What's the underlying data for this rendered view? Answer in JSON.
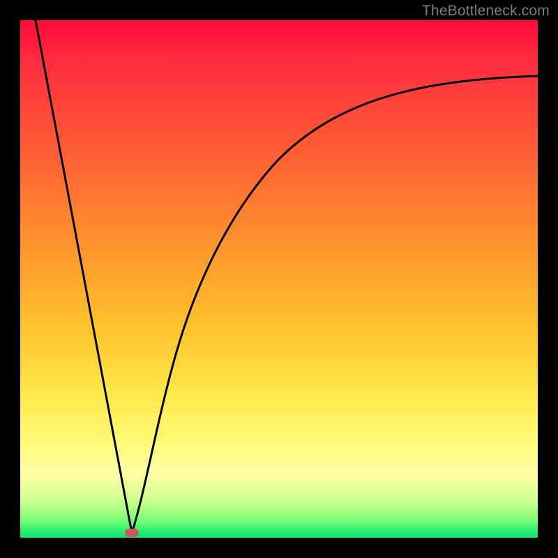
{
  "watermark": "TheBottleneck.com",
  "marker": {
    "x_frac": 0.215,
    "color": "#cb5a5f"
  },
  "chart_data": {
    "type": "line",
    "title": "",
    "xlabel": "",
    "ylabel": "",
    "xlim": [
      0,
      1
    ],
    "ylim": [
      0,
      1
    ],
    "background_gradient": [
      "#ff0a3a",
      "#ff8f2e",
      "#ffe74a",
      "#00e56b"
    ],
    "series": [
      {
        "name": "left-branch",
        "x": [
          0.03,
          0.06,
          0.09,
          0.12,
          0.15,
          0.18,
          0.215
        ],
        "values": [
          1.0,
          0.84,
          0.68,
          0.52,
          0.36,
          0.19,
          0.0
        ]
      },
      {
        "name": "right-branch",
        "x": [
          0.215,
          0.24,
          0.27,
          0.3,
          0.34,
          0.4,
          0.48,
          0.58,
          0.7,
          0.84,
          1.0
        ],
        "values": [
          0.0,
          0.13,
          0.26,
          0.37,
          0.48,
          0.6,
          0.7,
          0.78,
          0.84,
          0.87,
          0.89
        ]
      }
    ],
    "marker": {
      "x": 0.215,
      "y": 0.0
    }
  }
}
